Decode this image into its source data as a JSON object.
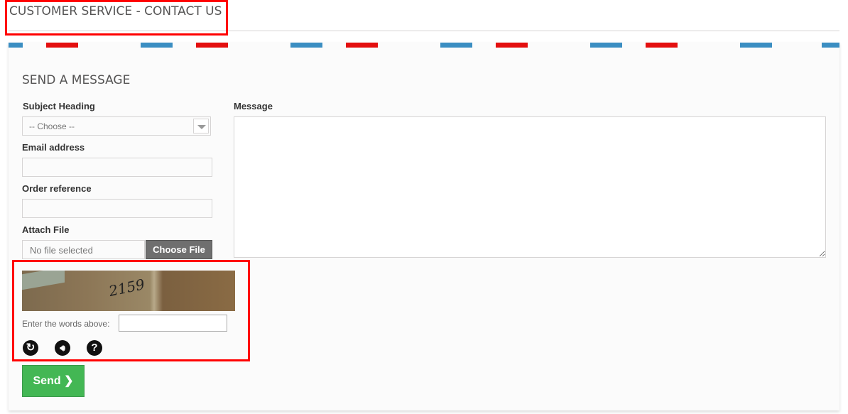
{
  "page_title": "CUSTOMER SERVICE - CONTACT US",
  "form": {
    "title": "SEND A MESSAGE",
    "subject_label": "Subject Heading",
    "subject_value": "-- Choose --",
    "email_label": "Email address",
    "email_value": "",
    "order_label": "Order reference",
    "order_value": "",
    "attach_label": "Attach File",
    "file_status": "No file selected",
    "choose_file": "Choose File",
    "message_label": "Message",
    "message_value": ""
  },
  "captcha": {
    "image_text": "2159",
    "prompt": "Enter the words above:",
    "value": "",
    "icons": [
      "refresh-icon",
      "audio-icon",
      "help-icon"
    ]
  },
  "send_label": "Send",
  "colors": {
    "highlight": "#ff0000",
    "send": "#43b754",
    "stripe_red": "#e40f0f",
    "stripe_blue": "#3b8ec2"
  }
}
